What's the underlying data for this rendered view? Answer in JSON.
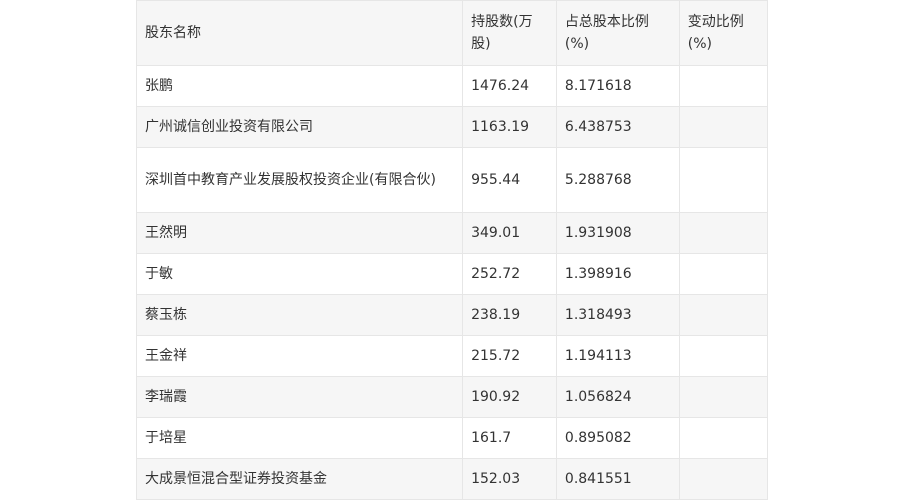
{
  "headers": [
    "股东名称",
    "持股数(万股)",
    "占总股本比例(%)",
    "变动比例(%)"
  ],
  "rows": [
    {
      "name": "张鹏",
      "shares": "1476.24",
      "ratio": "8.171618",
      "change": ""
    },
    {
      "name": "广州诚信创业投资有限公司",
      "shares": "1163.19",
      "ratio": "6.438753",
      "change": ""
    },
    {
      "name": "深圳首中教育产业发展股权投资企业(有限合伙)",
      "shares": "955.44",
      "ratio": "5.288768",
      "change": ""
    },
    {
      "name": "王然明",
      "shares": "349.01",
      "ratio": "1.931908",
      "change": ""
    },
    {
      "name": "于敏",
      "shares": "252.72",
      "ratio": "1.398916",
      "change": ""
    },
    {
      "name": "蔡玉栋",
      "shares": "238.19",
      "ratio": "1.318493",
      "change": ""
    },
    {
      "name": "王金祥",
      "shares": "215.72",
      "ratio": "1.194113",
      "change": ""
    },
    {
      "name": "李瑞霞",
      "shares": "190.92",
      "ratio": "1.056824",
      "change": ""
    },
    {
      "name": "于培星",
      "shares": "161.7",
      "ratio": "0.895082",
      "change": ""
    },
    {
      "name": "大成景恒混合型证券投资基金",
      "shares": "152.03",
      "ratio": "0.841551",
      "change": ""
    }
  ]
}
